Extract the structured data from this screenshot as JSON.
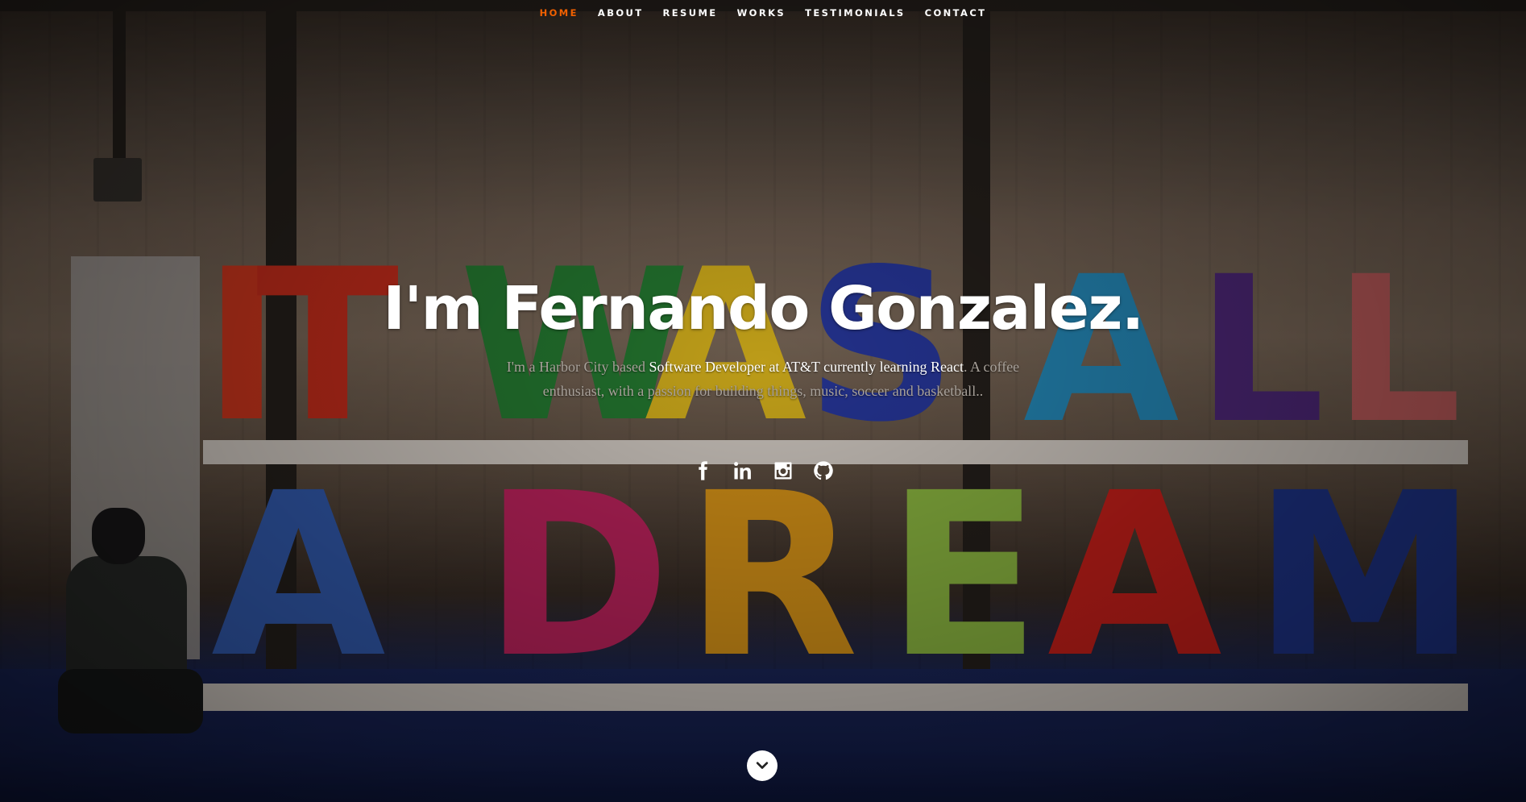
{
  "nav": {
    "items": [
      {
        "label": "HOME",
        "current": true
      },
      {
        "label": "ABOUT",
        "current": false
      },
      {
        "label": "RESUME",
        "current": false
      },
      {
        "label": "WORKS",
        "current": false
      },
      {
        "label": "TESTIMONIALS",
        "current": false
      },
      {
        "label": "CONTACT",
        "current": false
      }
    ],
    "active_color": "#f06000"
  },
  "banner": {
    "headline": "I'm Fernando Gonzalez.",
    "intro": {
      "part1": "I'm a Harbor City based ",
      "highlight1": "Software Developer at AT&T currently learning React",
      "part2": ". A coffee enthusiast, with a passion for building things, music, soccer and basketball.."
    }
  },
  "social": [
    {
      "name": "facebook-icon"
    },
    {
      "name": "linkedin-icon"
    },
    {
      "name": "instagram-icon"
    },
    {
      "name": "github-icon"
    }
  ],
  "background": {
    "letters_row1": [
      "I",
      "T",
      "W",
      "A",
      "S",
      "A",
      "L",
      "L"
    ],
    "letters_row2": [
      "A",
      "D",
      "R",
      "E",
      "A",
      "M"
    ]
  }
}
